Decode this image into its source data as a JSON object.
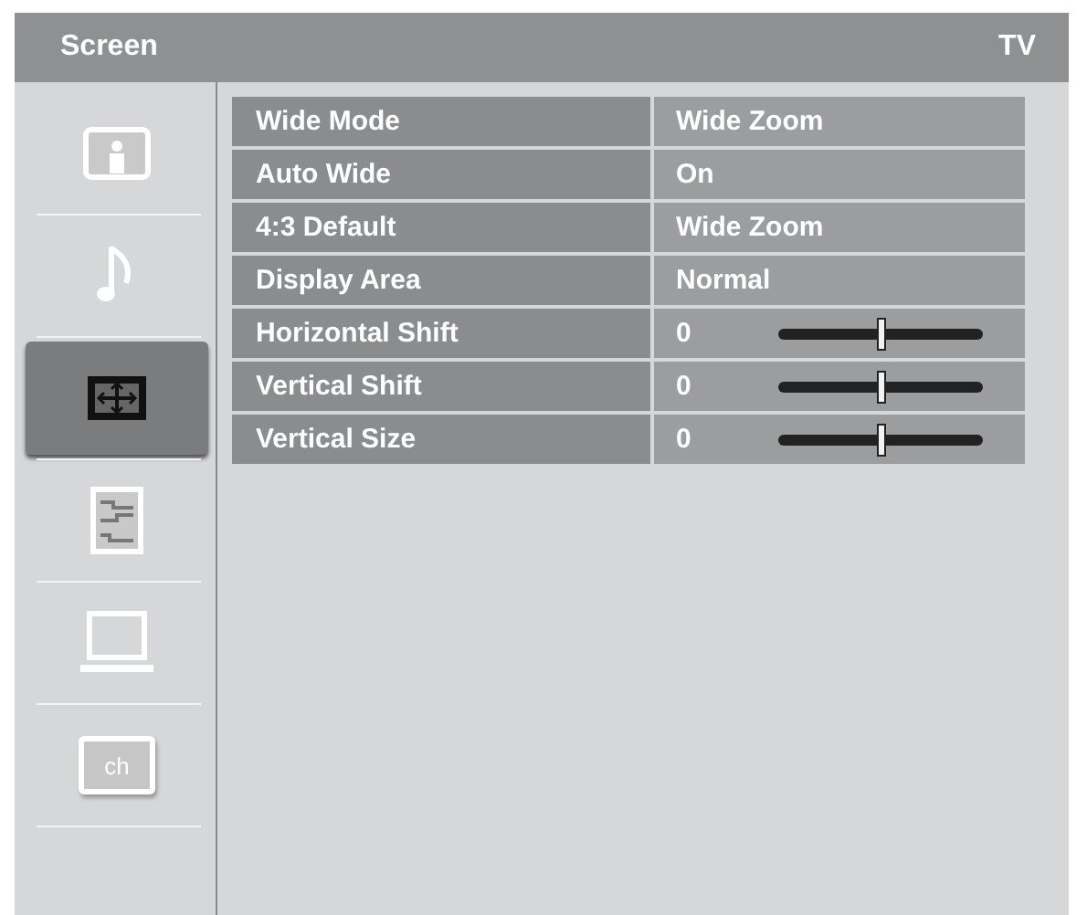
{
  "header": {
    "title": "Screen",
    "source": "TV"
  },
  "sidebar": {
    "items": [
      {
        "kind": "picture",
        "selected": false
      },
      {
        "kind": "sound",
        "selected": false
      },
      {
        "kind": "screen",
        "selected": true
      },
      {
        "kind": "setup",
        "selected": false
      },
      {
        "kind": "pc",
        "selected": false
      },
      {
        "kind": "channel",
        "label": "ch",
        "selected": false
      }
    ]
  },
  "settings": [
    {
      "kind": "option",
      "label": "Wide Mode",
      "value": "Wide Zoom"
    },
    {
      "kind": "option",
      "label": "Auto Wide",
      "value": "On"
    },
    {
      "kind": "option",
      "label": "4:3 Default",
      "value": "Wide Zoom"
    },
    {
      "kind": "option",
      "label": "Display Area",
      "value": "Normal"
    },
    {
      "kind": "slider",
      "label": "Horizontal Shift",
      "value": "0",
      "level": 0.5
    },
    {
      "kind": "slider",
      "label": "Vertical Shift",
      "value": "0",
      "level": 0.5
    },
    {
      "kind": "slider",
      "label": "Vertical Size",
      "value": "0",
      "level": 0.5
    }
  ]
}
